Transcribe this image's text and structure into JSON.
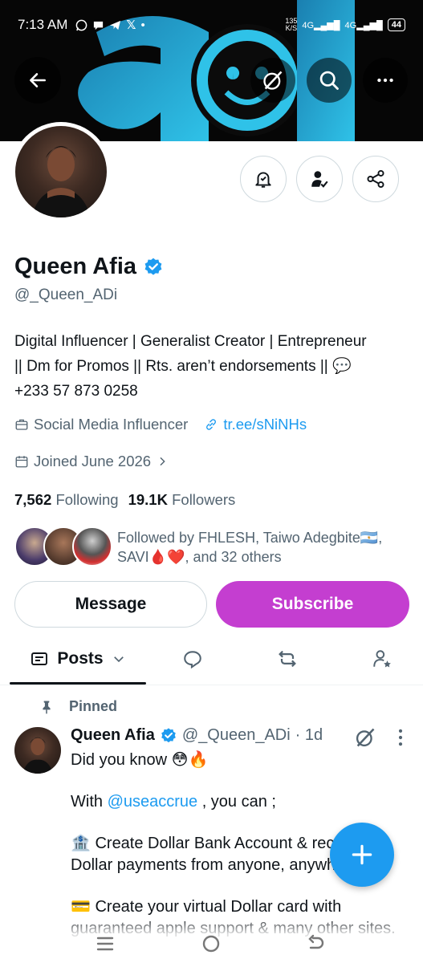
{
  "status_bar": {
    "time": "7:13 AM",
    "net_speed_top": "135",
    "net_speed_unit": "K/S",
    "signal_1": "4G",
    "signal_2": "4G",
    "battery": "44"
  },
  "profile": {
    "display_name": "Queen Afia",
    "handle": "@_Queen_ADi",
    "verified": true,
    "bio_line_1": "Digital Influencer | Generalist Creator | Entrepreneur",
    "bio_line_2": "|| Dm for Promos || Rts. aren’t endorsements || 💬",
    "bio_line_3": "+233 57 873 0258",
    "category": "Social Media Influencer",
    "link": "tr.ee/sNiNHs",
    "joined": "Joined June 2026",
    "following_count": "7,562",
    "following_label": "Following",
    "followers_count": "19.1K",
    "followers_label": "Followers",
    "followed_by_line_1": "Followed by FHLESH, Taiwo Adegbite🇦🇷,",
    "followed_by_line_2": "SAVI🩸❤️, and 32 others"
  },
  "actions": {
    "message_label": "Message",
    "subscribe_label": "Subscribe"
  },
  "tabs": {
    "posts_label": "Posts"
  },
  "pinned_post": {
    "pinned_label": "Pinned",
    "author_name": "Queen Afia",
    "author_handle": "@_Queen_ADi",
    "time": "· 1d",
    "line_1": "Did you know 😳🔥",
    "line_2_prefix": "With ",
    "line_2_mention": "@useaccrue",
    "line_2_suffix": " , you can ;",
    "line_3": "🏦 Create Dollar Bank Account & receive Dollar payments from anyone, anywhere.",
    "line_4": "💳 Create your virtual Dollar card with guaranteed apple support & many other sites."
  },
  "colors": {
    "accent": "#1d9bf0",
    "subscribe": "#c43ed0",
    "text": "#0f1419",
    "secondary_text": "#536471",
    "border": "#cfd9de"
  },
  "icons": {
    "back": "arrow-left-icon",
    "grok": "grok-icon",
    "search": "search-icon",
    "more": "more-icon",
    "notifications": "bell-check-icon",
    "following": "person-check-icon",
    "share": "share-icon",
    "category": "briefcase-icon",
    "link": "link-icon",
    "calendar": "calendar-icon",
    "verified": "verified-badge-icon",
    "compose": "plus-icon",
    "pin": "pin-icon"
  }
}
